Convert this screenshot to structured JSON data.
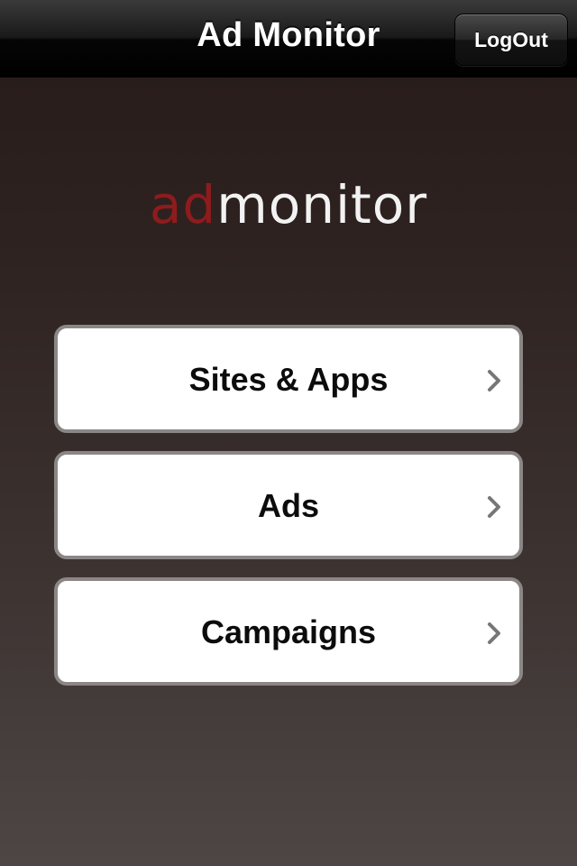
{
  "navbar": {
    "title": "Ad Monitor",
    "logout_label": "LogOut"
  },
  "logo": {
    "part1": "ad",
    "part2": "monitor",
    "colors": {
      "part1": "#8e1b1d",
      "part2": "#f2f2f2"
    }
  },
  "menu": {
    "items": [
      {
        "label": "Sites & Apps",
        "icon": "chevron-right-icon"
      },
      {
        "label": "Ads",
        "icon": "chevron-right-icon"
      },
      {
        "label": "Campaigns",
        "icon": "chevron-right-icon"
      }
    ]
  }
}
